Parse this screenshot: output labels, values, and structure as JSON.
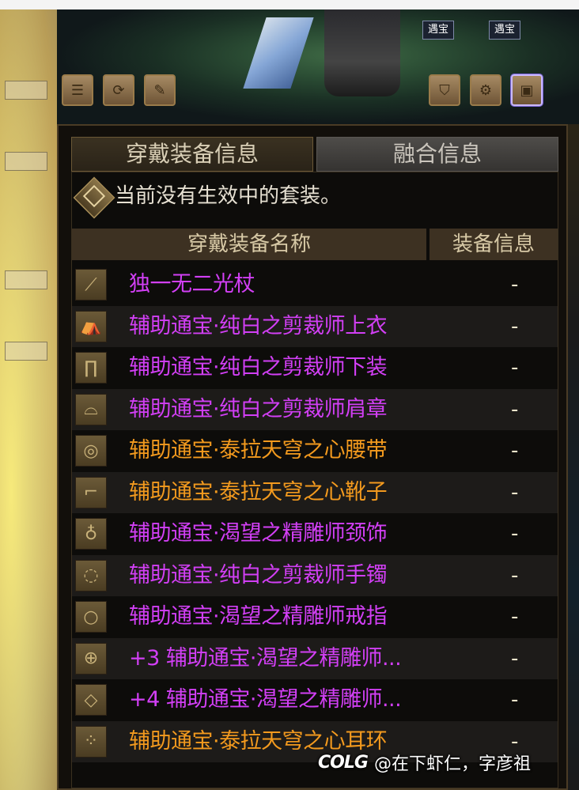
{
  "scene": {
    "tags": [
      "遇宝",
      "遇宝"
    ]
  },
  "panel": {
    "tabs": [
      {
        "label": "穿戴装备信息",
        "active": true
      },
      {
        "label": "融合信息",
        "active": false
      }
    ],
    "set_status": "当前没有生效中的套装。",
    "columns": {
      "name": "穿戴装备名称",
      "info": "装备信息"
    },
    "items": [
      {
        "name": "独一无二光杖",
        "info": "-",
        "color": "purple",
        "icon": "weapon-icon"
      },
      {
        "name": "辅助通宝·纯白之剪裁师上衣",
        "info": "-",
        "color": "purple",
        "icon": "top-icon"
      },
      {
        "name": "辅助通宝·纯白之剪裁师下装",
        "info": "-",
        "color": "purple",
        "icon": "pants-icon"
      },
      {
        "name": "辅助通宝·纯白之剪裁师肩章",
        "info": "-",
        "color": "purple",
        "icon": "shoulder-icon"
      },
      {
        "name": "辅助通宝·泰拉天穹之心腰带",
        "info": "-",
        "color": "orange",
        "icon": "belt-icon"
      },
      {
        "name": "辅助通宝·泰拉天穹之心靴子",
        "info": "-",
        "color": "orange",
        "icon": "shoes-icon"
      },
      {
        "name": "辅助通宝·渴望之精雕师颈饰",
        "info": "-",
        "color": "purple",
        "icon": "necklace-icon"
      },
      {
        "name": "辅助通宝·纯白之剪裁师手镯",
        "info": "-",
        "color": "purple",
        "icon": "bracelet-icon"
      },
      {
        "name": "辅助通宝·渴望之精雕师戒指",
        "info": "-",
        "color": "purple",
        "icon": "ring-icon"
      },
      {
        "name": "+3 辅助通宝·渴望之精雕师...",
        "info": "-",
        "color": "purple",
        "icon": "subequip-icon"
      },
      {
        "name": "+4 辅助通宝·渴望之精雕师...",
        "info": "-",
        "color": "purple",
        "icon": "magicstone-icon"
      },
      {
        "name": "辅助通宝·泰拉天穹之心耳环",
        "info": "-",
        "color": "orange",
        "icon": "earring-icon"
      }
    ],
    "colors": {
      "purple": "#d23ff5",
      "orange": "#f39a1e"
    }
  },
  "watermark": {
    "logo": "COLG",
    "text": "@在下虾仁，字彦祖"
  }
}
